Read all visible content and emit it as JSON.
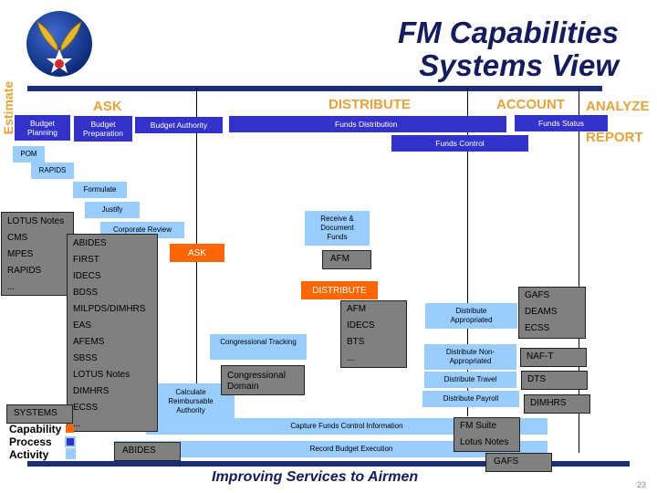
{
  "header": {
    "title_line1": "FM Capabilities",
    "title_line2": "Systems View",
    "side_label": "Estimate"
  },
  "phases": {
    "ask": "ASK",
    "distribute": "DISTRIBUTE",
    "account": "ACCOUNT",
    "analyze_line1": "ANALYZE &",
    "analyze_line2": "REPORT"
  },
  "processes": {
    "budget_planning": "Budget Planning",
    "budget_preparation": "Budget Preparation",
    "budget_authority": "Budget Authority",
    "funds_distribution": "Funds Distribution",
    "funds_status": "Funds Status",
    "funds_control": "Funds Control"
  },
  "activities": {
    "pom": "POM",
    "rapids": "RAPIDS",
    "formulate": "Formulate",
    "justify": "Justify",
    "corporate_review": "Corporate Review",
    "receive_document": "Receive & Document Funds",
    "congressional_tracking": "Congressional Tracking",
    "calc_reimbursable": "Calculate Reimbursable Authority",
    "distribute_appropriated": "Distribute Appropriated",
    "distribute_nonappropriated": "Distribute Non-Appropriated",
    "distribute_travel": "Distribute Travel",
    "distribute_payroll": "Distribute Payroll",
    "capture_funds_control": "Capture Funds Control Information",
    "record_budget_execution": "Record Budget Execution"
  },
  "capabilities": {
    "ask": "ASK",
    "distribute": "DISTRIBUTE"
  },
  "systems": {
    "estimate_box": [
      "LOTUS Notes",
      "CMS",
      "MPES",
      "RAPIDS",
      "..."
    ],
    "ask_box": [
      "ABIDES",
      "FIRST",
      "IDECS",
      "BDSS",
      "MILPDS/DIMHRS",
      "EAS",
      "AFEMS",
      "SBSS",
      "LOTUS Notes",
      "DIMHRS",
      "ECSS",
      "..."
    ],
    "afm_single": "AFM",
    "distribute_box": [
      "AFM",
      "IDECS",
      "BTS",
      "..."
    ],
    "congressional_domain": "Congressional Domain",
    "appropriated_box": [
      "GAFS",
      "DEAMS",
      "ECSS"
    ],
    "naf_t": "NAF-T",
    "dts": "DTS",
    "dimhrs": "DIMHRS",
    "fm_suite_box": [
      "FM Suite",
      "Lotus Notes"
    ],
    "gafs_bottom": "GAFS",
    "abides_bottom": "ABIDES"
  },
  "legend": {
    "systems": "SYSTEMS",
    "capability": "Capability",
    "process": "Process",
    "activity": "Activity",
    "colors": {
      "capability": "#ff6600",
      "process": "#3333cc",
      "activity": "#99ccff",
      "system": "#808080"
    }
  },
  "footer": {
    "tagline": "Improving Services to Airmen",
    "page_number": "23"
  }
}
